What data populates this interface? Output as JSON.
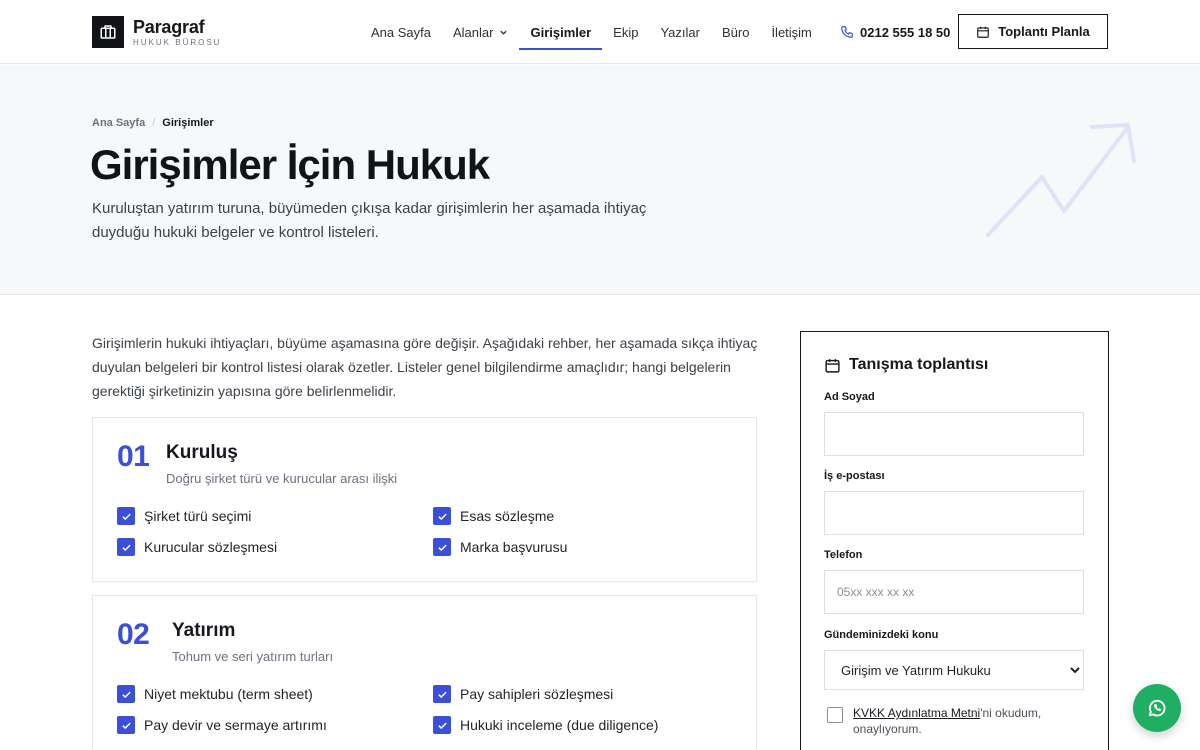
{
  "brand": {
    "name": "Paragraf",
    "tagline": "HUKUK BÜROSU"
  },
  "nav": {
    "items": [
      {
        "label": "Ana Sayfa"
      },
      {
        "label": "Alanlar"
      },
      {
        "label": "Girişimler"
      },
      {
        "label": "Ekip"
      },
      {
        "label": "Yazılar"
      },
      {
        "label": "Büro"
      },
      {
        "label": "İletişim"
      }
    ],
    "active": "Girişimler",
    "phone": "0212 555 18 50",
    "cta": "Toplantı Planla"
  },
  "breadcrumb": {
    "home": "Ana Sayfa",
    "separator": "/",
    "current": "Girişimler"
  },
  "hero": {
    "title": "Girişimler İçin Hukuk",
    "description": "Kuruluştan yatırım turuna, büyümeden çıkışa kadar girişimlerin her aşamada ihtiyaç duyduğu hukuki belgeler ve kontrol listeleri."
  },
  "intro": "Girişimlerin hukuki ihtiyaçları, büyüme aşamasına göre değişir. Aşağıdaki rehber, her aşamada sıkça ihtiyaç duyulan belgeleri bir kontrol listesi olarak özetler. Listeler genel bilgilendirme amaçlıdır; hangi belgelerin gerektiği şirketinizin yapısına göre belirlenmelidir.",
  "stages": [
    {
      "number": "01",
      "title": "Kuruluş",
      "subtitle": "Doğru şirket türü ve kurucular arası ilişki",
      "items": [
        "Şirket türü seçimi",
        "Esas sözleşme",
        "Kurucular sözleşmesi",
        "Marka başvurusu"
      ]
    },
    {
      "number": "02",
      "title": "Yatırım",
      "subtitle": "Tohum ve seri yatırım turları",
      "items": [
        "Niyet mektubu (term sheet)",
        "Pay sahipleri sözleşmesi",
        "Pay devir ve sermaye artırımı",
        "Hukuki inceleme (due diligence)"
      ]
    }
  ],
  "form": {
    "title": "Tanışma toplantısı",
    "name_label": "Ad Soyad",
    "name_value": "",
    "email_label": "İş e-postası",
    "email_value": "",
    "phone_label": "Telefon",
    "phone_placeholder": "05xx xxx xx xx",
    "topic_label": "Gündeminizdeki konu",
    "topic_selected": "Girişim ve Yatırım Hukuku",
    "consent_link": "KVKK Aydınlatma Metni",
    "consent_rest": "'ni okudum, onaylıyorum."
  },
  "colors": {
    "accent": "#3b4fd8",
    "ink": "#16181d",
    "hero_bg": "#f7f8fa",
    "whatsapp": "#1faf62"
  },
  "icons": {
    "logo": "briefcase-icon",
    "phone": "phone-icon",
    "calendar": "calendar-icon",
    "check": "check-icon",
    "whatsapp": "whatsapp-icon",
    "dropdown": "chevron-down-icon"
  }
}
